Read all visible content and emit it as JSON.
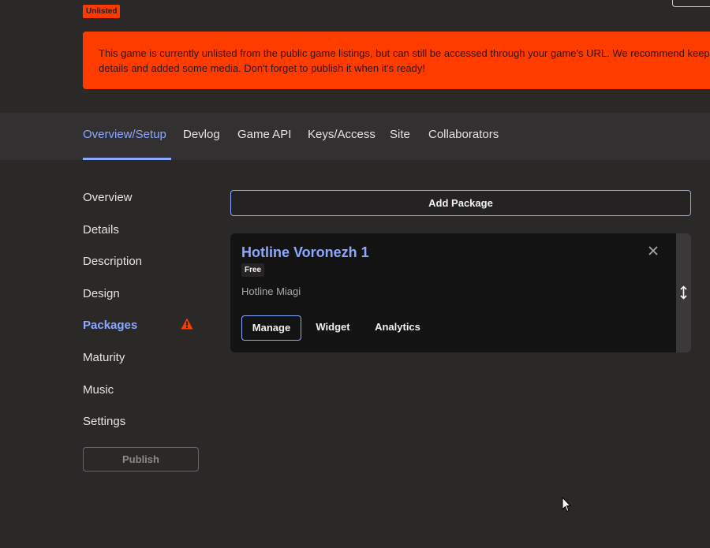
{
  "badge": {
    "unlisted": "Unlisted"
  },
  "alert": {
    "line1": "This game is currently unlisted from the public game listings, but can still be accessed through your game's URL. We recommend keeping it u",
    "line2": "details and added some media. Don't forget to publish it when it's ready!"
  },
  "tabs": [
    {
      "label": "Overview/Setup",
      "active": true
    },
    {
      "label": "Devlog"
    },
    {
      "label": "Game API"
    },
    {
      "label": "Keys/Access"
    },
    {
      "label": "Site"
    },
    {
      "label": "Collaborators"
    }
  ],
  "sidebar": {
    "items": [
      {
        "label": "Overview"
      },
      {
        "label": "Details"
      },
      {
        "label": "Description"
      },
      {
        "label": "Design"
      },
      {
        "label": "Packages",
        "active": true,
        "icon": "warning-icon"
      },
      {
        "label": "Maturity"
      },
      {
        "label": "Music"
      },
      {
        "label": "Settings"
      }
    ],
    "publish_label": "Publish"
  },
  "main": {
    "add_package_label": "Add Package",
    "package": {
      "title": "Hotline Voronezh 1",
      "price_badge": "Free",
      "file_name": "Hotline Miagi",
      "buttons": {
        "manage": "Manage",
        "widget": "Widget",
        "analytics": "Analytics"
      }
    }
  },
  "colors": {
    "accent": "#8aa9ff",
    "alert": "#ff3c00",
    "background": "#2b2928",
    "card": "#141313"
  }
}
